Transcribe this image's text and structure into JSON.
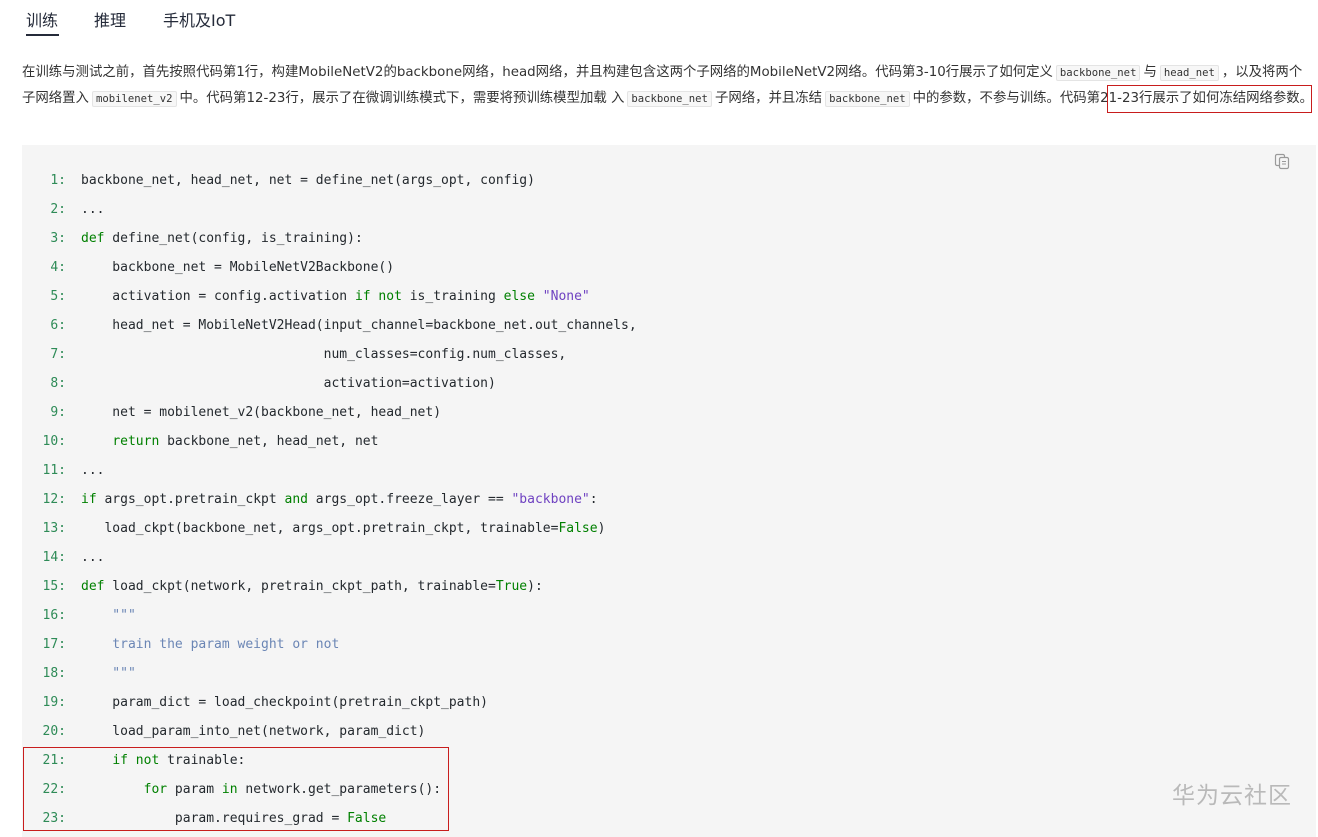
{
  "tabs": [
    "训练",
    "推理",
    "手机及IoT"
  ],
  "active_tab": "训练",
  "paragraph": {
    "p1": "在训练与测试之前，首先按照代码第1行，构建MobileNetV2的backbone网络，head网络，并且构建包含这两个子网络的MobileNetV2网络。代码第3-10行展示了如何定义",
    "c1": "backbone_net",
    "p2": "与",
    "c2": "head_net",
    "p3": "，以及将两个子网络置入",
    "c3": "mobilenet_v2",
    "p4": "中。代码第12-23行，展示了在微调训练模式下，需要将预训练模型加载 入",
    "c4": "backbone_net",
    "p5": "子网络，并且冻结",
    "c5": "backbone_net",
    "p6": "中的参数，不参与训练。代码第21-23行展示了如何冻结网络参数。"
  },
  "code_lines": [
    {
      "n": "1:",
      "t": "backbone_net, head_net, net = define_net(args_opt, config)"
    },
    {
      "n": "2:",
      "t": "..."
    },
    {
      "n": "3:",
      "t": "def define_net(config, is_training):"
    },
    {
      "n": "4:",
      "t": "    backbone_net = MobileNetV2Backbone()"
    },
    {
      "n": "5:",
      "t": "    activation = config.activation if not is_training else \"None\""
    },
    {
      "n": "6:",
      "t": "    head_net = MobileNetV2Head(input_channel=backbone_net.out_channels,"
    },
    {
      "n": "7:",
      "t": "                               num_classes=config.num_classes,"
    },
    {
      "n": "8:",
      "t": "                               activation=activation)"
    },
    {
      "n": "9:",
      "t": "    net = mobilenet_v2(backbone_net, head_net)"
    },
    {
      "n": "10:",
      "t": "    return backbone_net, head_net, net"
    },
    {
      "n": "11:",
      "t": "..."
    },
    {
      "n": "12:",
      "t": "if args_opt.pretrain_ckpt and args_opt.freeze_layer == \"backbone\":"
    },
    {
      "n": "13:",
      "t": "   load_ckpt(backbone_net, args_opt.pretrain_ckpt, trainable=False)"
    },
    {
      "n": "14:",
      "t": "..."
    },
    {
      "n": "15:",
      "t": "def load_ckpt(network, pretrain_ckpt_path, trainable=True):"
    },
    {
      "n": "16:",
      "t": "    \"\"\""
    },
    {
      "n": "17:",
      "t": "    train the param weight or not"
    },
    {
      "n": "18:",
      "t": "    \"\"\""
    },
    {
      "n": "19:",
      "t": "    param_dict = load_checkpoint(pretrain_ckpt_path)"
    },
    {
      "n": "20:",
      "t": "    load_param_into_net(network, param_dict)"
    },
    {
      "n": "21:",
      "t": "    if not trainable:"
    },
    {
      "n": "22:",
      "t": "        for param in network.get_parameters():"
    },
    {
      "n": "23:",
      "t": "            param.requires_grad = False"
    }
  ],
  "watermark": "华为云社区",
  "icons": {
    "copy": "copy-icon"
  },
  "colors": {
    "highlight_border": "#c81d1d",
    "code_bg": "#f5f5f5",
    "line_number": "#2e8b57",
    "keyword": "#008000"
  }
}
